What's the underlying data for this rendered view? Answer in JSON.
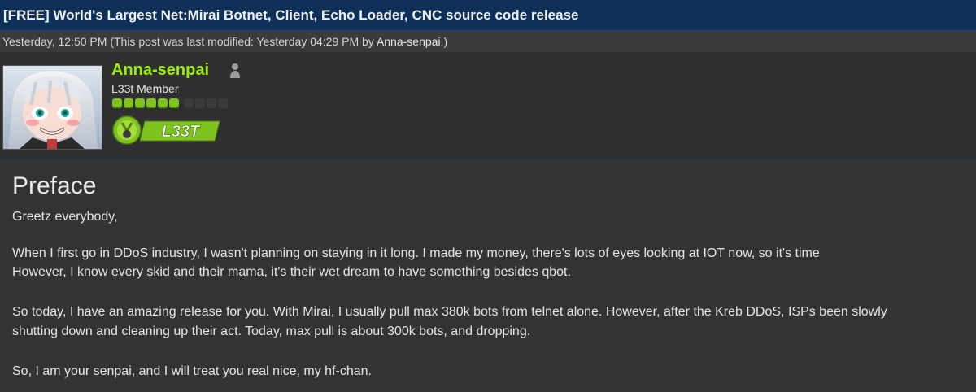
{
  "thread": {
    "title": "[FREE] World's Largest Net:Mirai Botnet, Client, Echo Loader, CNC source code release"
  },
  "meta": {
    "posted": "Yesterday, 12:50 PM",
    "modified_prefix": "(This post was last modified: Yesterday 04:29 PM by ",
    "modified_by": "Anna-senpai",
    "modified_suffix": ".)"
  },
  "author": {
    "username": "Anna-senpai",
    "usertitle": "L33t Member",
    "status_icon": "user-offline-icon",
    "rank_stars": 6,
    "rank_stars_total": 10,
    "award_text": "L33T",
    "colors": {
      "username": "#99ee00",
      "award_green": "#7fc321"
    }
  },
  "post": {
    "heading": "Preface",
    "lines": [
      "Greetz everybody,",
      "When I first go in DDoS industry, I wasn't planning on staying in it long. I made my money, there's lots of eyes looking at IOT now, so it's time",
      "However, I know every skid and their mama, it's their wet dream to have something besides qbot.",
      "So today, I have an amazing release for you. With Mirai, I usually pull max 380k bots from telnet alone. However, after the Kreb DDoS, ISPs been slowly",
      "shutting down and cleaning up their act. Today, max pull is about 300k bots, and dropping.",
      "So, I am your senpai, and I will treat you real nice, my hf-chan."
    ]
  }
}
